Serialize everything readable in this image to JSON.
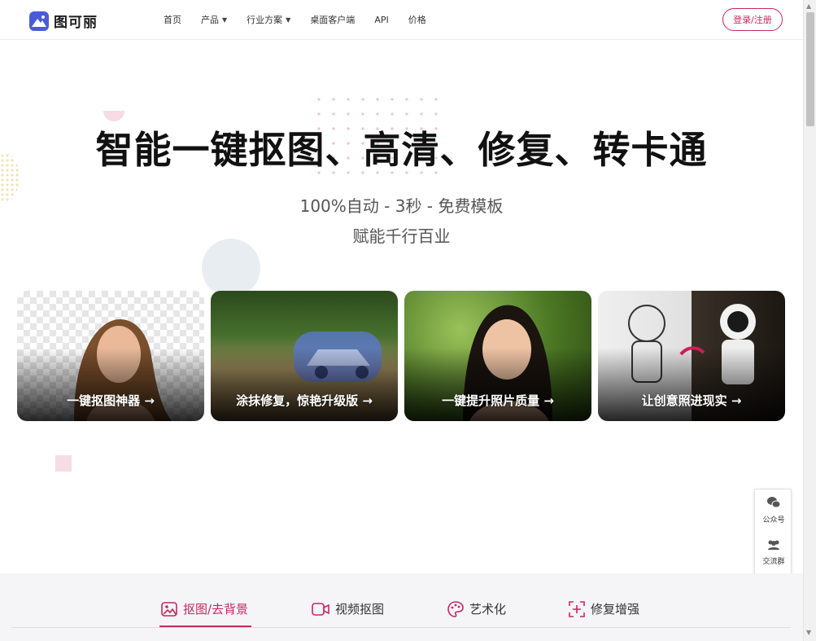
{
  "header": {
    "logo_text": "图可丽",
    "nav": [
      {
        "label": "首页",
        "has_caret": false
      },
      {
        "label": "产品",
        "has_caret": true
      },
      {
        "label": "行业方案",
        "has_caret": true
      },
      {
        "label": "桌面客户端",
        "has_caret": false
      },
      {
        "label": "API",
        "has_caret": false
      },
      {
        "label": "价格",
        "has_caret": false
      }
    ],
    "login_label": "登录/注册"
  },
  "hero": {
    "title": "智能一键抠图、高清、修复、转卡通",
    "subtitle": "100%自动 - 3秒 - 免费模板",
    "subtitle2": "赋能千行百业"
  },
  "cards": [
    {
      "label": "一键抠图神器 →"
    },
    {
      "label": "涂抹修复，惊艳升级版 →"
    },
    {
      "label": "一键提升照片质量 →"
    },
    {
      "label": "让创意照进现实 →"
    }
  ],
  "float_panel": {
    "items": [
      {
        "label": "公众号",
        "icon": "wechat-icon"
      },
      {
        "label": "交流群",
        "icon": "group-icon"
      },
      {
        "label": "",
        "icon": "back-to-top-icon"
      }
    ]
  },
  "tabs": [
    {
      "label": "抠图/去背景",
      "icon": "image-icon",
      "active": true
    },
    {
      "label": "视频抠图",
      "icon": "video-icon",
      "active": false
    },
    {
      "label": "艺术化",
      "icon": "palette-icon",
      "active": false
    },
    {
      "label": "修复增强",
      "icon": "enhance-icon",
      "active": false
    }
  ],
  "colors": {
    "accent": "#c8285c",
    "logo_bg": "#4a5bd8",
    "tabs_bg": "#f5f5f7"
  }
}
